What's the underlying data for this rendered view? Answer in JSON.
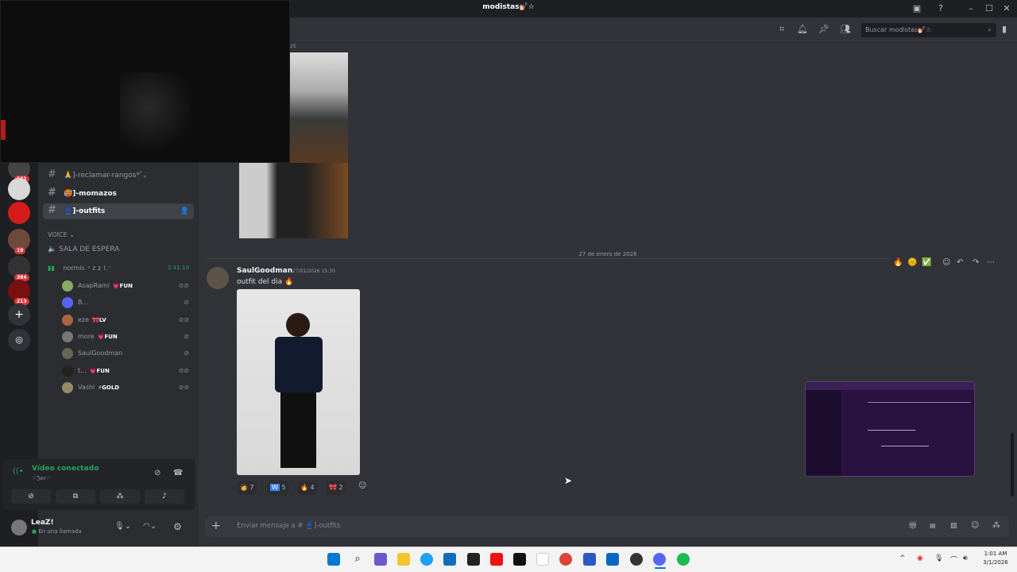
{
  "window": {
    "title": "modistas💅🏻☆"
  },
  "search": {
    "placeholder": "Buscar modistas💅🏻☆"
  },
  "rail": {
    "badges": [
      "131",
      "19",
      "384",
      "213"
    ]
  },
  "channels": [
    {
      "emoji": "🙏",
      "label": "]-reclamar-rangos*ﾟ｡"
    },
    {
      "emoji": "🥵",
      "label": "]-momazos"
    },
    {
      "emoji": "👖",
      "label": "]-outfits"
    }
  ],
  "voice": {
    "category": "VOICE",
    "waiting_room": "SALA DE ESPERA",
    "channel_name": "normis˙ᶻ z 𝗓 ⌇.ᐟ",
    "timer": "2:41:10",
    "users": [
      {
        "name": "AsapRami",
        "tag": "💗FUN"
      },
      {
        "name": "B...",
        "tag": ""
      },
      {
        "name": "eze",
        "tag": "🎀LV"
      },
      {
        "name": "more",
        "tag": "💗FUN"
      },
      {
        "name": "SaulGoodman",
        "tag": ""
      },
      {
        "name": "t...",
        "tag": "💗FUN"
      },
      {
        "name": "Vashi",
        "tag": "⚡GOLD"
      }
    ]
  },
  "connection": {
    "status": "Vídeo conectado",
    "sub": "♡𝔍𝔞𝔫♡"
  },
  "user": {
    "name": "LeaZ!",
    "status": "En una llamada"
  },
  "messages": {
    "top_timestamp_fragment": "25",
    "date_divider": "27 de enero de 2026",
    "author": "SaulGoodman",
    "timestamp": "27/01/2026 15:30",
    "text": "outfit del dia 🔥",
    "reactions": [
      {
        "emoji": "🧑",
        "count": "7"
      },
      {
        "emoji": "W",
        "count": "5"
      },
      {
        "emoji": "🔥",
        "count": "4"
      },
      {
        "emoji": "🎀",
        "count": "2"
      }
    ]
  },
  "composer": {
    "placeholder": "Enviar mensaje a # 👖]-outfits"
  },
  "clock": {
    "time": "1:01 AM",
    "date": "3/1/2026"
  },
  "colors": {
    "accent": "#5865f2",
    "green": "#23a55a",
    "red": "#da373c"
  }
}
